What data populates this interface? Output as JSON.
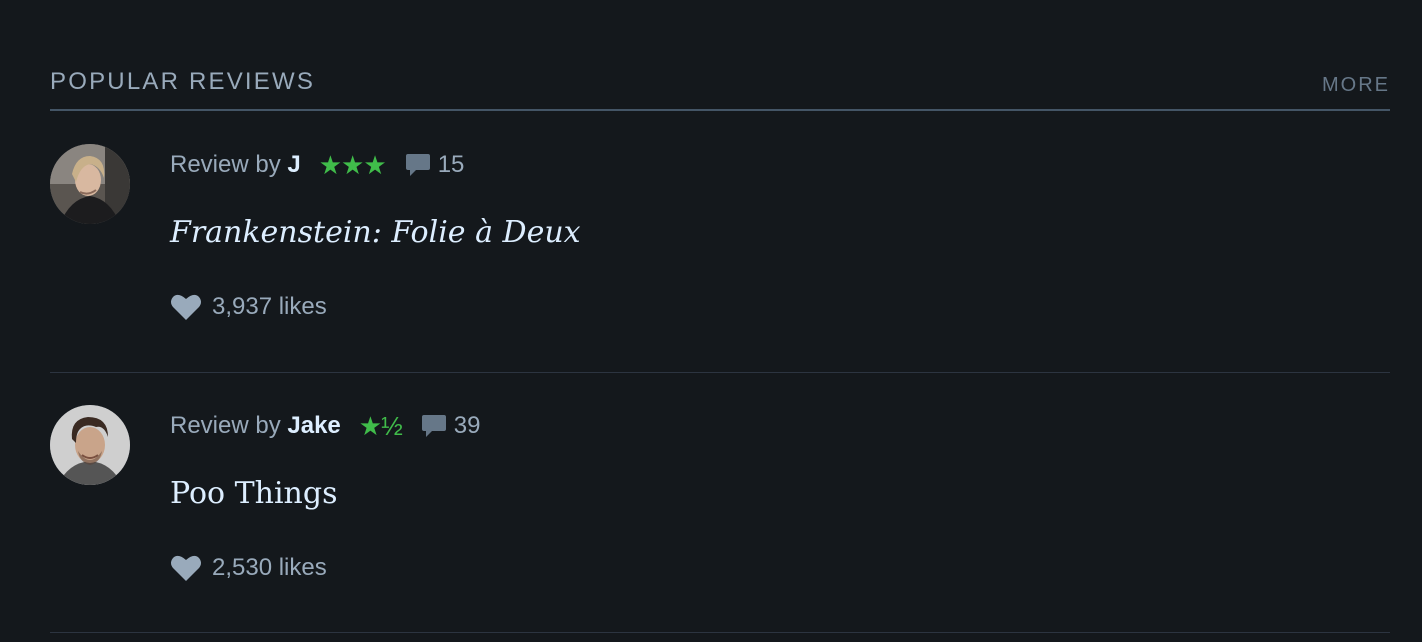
{
  "section": {
    "title": "POPULAR REVIEWS",
    "more_label": "MORE"
  },
  "reviews": [
    {
      "review_by_label": "Review by",
      "author": "J",
      "rating_stars": "★★★",
      "comment_count": "15",
      "film_title": "Frankenstein: Folie à Deux",
      "title_style": "italic",
      "likes": "3,937 likes",
      "avatar_icon": "user-avatar-icon"
    },
    {
      "review_by_label": "Review by",
      "author": "Jake",
      "rating_stars": "★½",
      "comment_count": "39",
      "film_title": "Poo Things",
      "title_style": "normal",
      "likes": "2,530 likes",
      "avatar_icon": "user-avatar-icon"
    }
  ],
  "colors": {
    "background": "#14181c",
    "muted_text": "#99aabb",
    "bright_text": "#ddeeff",
    "star_green": "#40bc4a",
    "divider": "#445566"
  },
  "icons": {
    "comment": "comment-bubble-icon",
    "like": "heart-icon"
  }
}
